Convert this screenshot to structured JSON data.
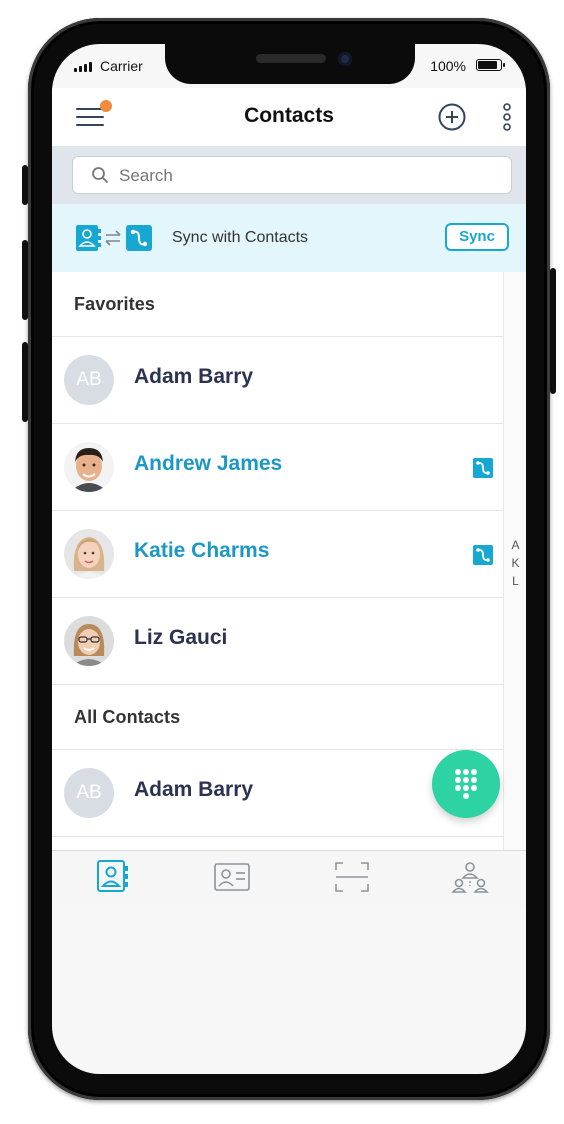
{
  "status_bar": {
    "carrier": "Carrier",
    "battery": "100%"
  },
  "header": {
    "title": "Contacts"
  },
  "search": {
    "placeholder": "Search"
  },
  "sync": {
    "text": "Sync with Contacts",
    "button": "Sync"
  },
  "favorites": {
    "title": "Favorites",
    "contacts": [
      {
        "name": "Adam Barry",
        "initials": "AB"
      },
      {
        "name": "Andrew James"
      },
      {
        "name": "Katie Charms"
      },
      {
        "name": "Liz Gauci"
      }
    ]
  },
  "all_contacts": {
    "title": "All Contacts",
    "contacts": [
      {
        "name": "Adam Barry",
        "initials": "AB"
      }
    ]
  },
  "index_letters": [
    "A",
    "K",
    "L"
  ],
  "tabs": [
    "contacts-book-icon",
    "id-card-icon",
    "scan-icon",
    "team-icon"
  ],
  "colors": {
    "accent": "#1c98c6",
    "fab": "#2ed3a3",
    "notification": "#ef8c3e",
    "sync_band": "#e3f6fb"
  }
}
